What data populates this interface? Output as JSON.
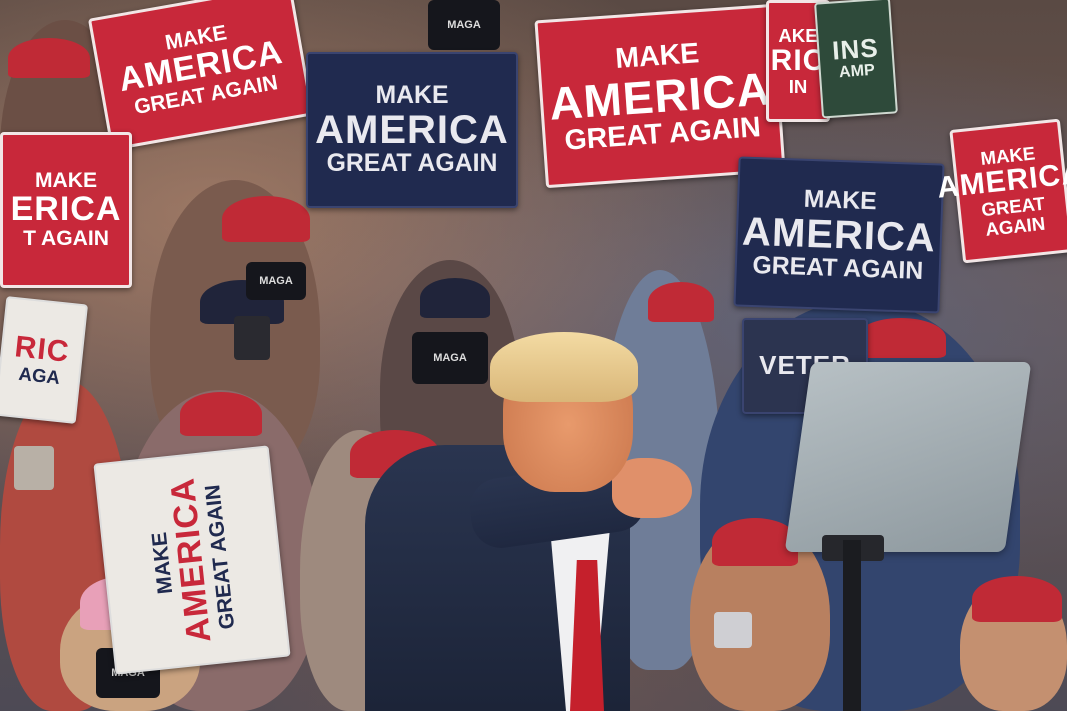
{
  "scene": {
    "description_alt": "Rally crowd holding campaign signs behind a speaker pointing forward",
    "colors": {
      "sign_red": "#c8283a",
      "sign_navy": "#202a4f",
      "sign_white": "#ece9e4",
      "sign_green": "#2e4a3a",
      "cap_red": "#c02a36"
    }
  },
  "signs": [
    {
      "line1": "MAKE",
      "line2": "AMERICA",
      "line3": "GREAT AGAIN"
    },
    {
      "line1": "MAKE",
      "line2": "AMERICA",
      "line3": "GREAT AGAIN"
    },
    {
      "line1": "MAKE",
      "line2": "AMERICA",
      "line3": "GREAT AGAIN"
    },
    {
      "line1": "MAKE",
      "line2": "AMERICA",
      "line3": "GREAT AGAIN"
    },
    {
      "line1": "MAKE",
      "line2": "AMERICA",
      "line3": "GREAT AGAIN"
    },
    {
      "line1": "MAKE",
      "line2": "ERICA",
      "line3": "T AGAIN"
    },
    {
      "line1": "MAKE",
      "line2": "AMERICA",
      "line3": "GREAT AGAIN"
    },
    {
      "line1": "AKE",
      "line2": "RIC",
      "line3": "IN"
    },
    {
      "line1": "",
      "line2": "RIC",
      "line3": "AGA"
    },
    {
      "line1": "",
      "line2": "VETER",
      "line3": ""
    },
    {
      "line1": "",
      "line2": "INS",
      "line3": "AMP"
    }
  ],
  "masks": [
    "MAGA",
    "MAGA",
    "MAGA",
    "MAGA"
  ]
}
